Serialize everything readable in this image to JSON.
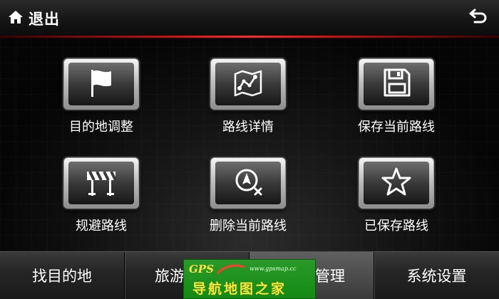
{
  "header": {
    "exit_label": "退出",
    "home_icon": "home-icon",
    "back_icon": "back-arrow-icon"
  },
  "tiles": [
    {
      "label": "目的地调整",
      "icon": "flag-icon"
    },
    {
      "label": "路线详情",
      "icon": "route-map-icon"
    },
    {
      "label": "保存当前路线",
      "icon": "floppy-disk-icon"
    },
    {
      "label": "规避路线",
      "icon": "roadblock-icon"
    },
    {
      "label": "删除当前路线",
      "icon": "delete-route-icon"
    },
    {
      "label": "已保存路线",
      "icon": "star-icon"
    }
  ],
  "bottom_tabs": [
    {
      "label": "找目的地"
    },
    {
      "label": "旅游"
    },
    {
      "label": "管理"
    },
    {
      "label": "系统设置"
    }
  ],
  "watermark": {
    "brand": "GPS",
    "url": "www.gpsmap.cc",
    "title": "导航地图之家"
  },
  "colors": {
    "accent_line": "#ff2a2a",
    "watermark_bg": "#138a13",
    "watermark_text": "#ffe23a"
  }
}
